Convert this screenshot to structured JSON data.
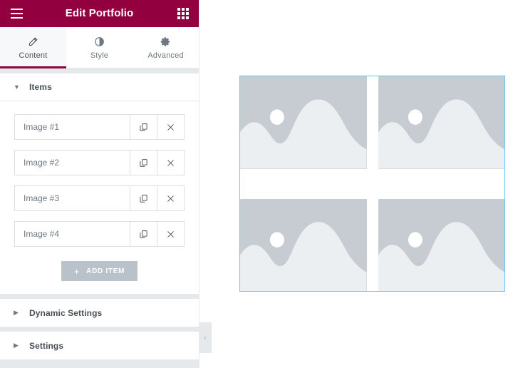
{
  "panel": {
    "header": {
      "menu_icon": "hamburger-menu-icon",
      "title": "Edit Portfolio",
      "apps_icon": "grid-apps-icon"
    },
    "tabs": [
      {
        "label": "Content",
        "icon": "pencil-icon",
        "active": true
      },
      {
        "label": "Style",
        "icon": "contrast-icon",
        "active": false
      },
      {
        "label": "Advanced",
        "icon": "gear-icon",
        "active": false
      }
    ],
    "sections": [
      {
        "id": "items",
        "title": "Items",
        "expanded": true,
        "caret": "▼"
      },
      {
        "id": "dynamic-settings",
        "title": "Dynamic Settings",
        "expanded": false,
        "caret": "▶"
      },
      {
        "id": "settings",
        "title": "Settings",
        "expanded": false,
        "caret": "▶"
      }
    ],
    "items": [
      {
        "label": "Image #1",
        "duplicate_icon": "duplicate-icon",
        "remove_icon": "close-icon"
      },
      {
        "label": "Image #2",
        "duplicate_icon": "duplicate-icon",
        "remove_icon": "close-icon"
      },
      {
        "label": "Image #3",
        "duplicate_icon": "duplicate-icon",
        "remove_icon": "close-icon"
      },
      {
        "label": "Image #4",
        "duplicate_icon": "duplicate-icon",
        "remove_icon": "close-icon"
      }
    ],
    "add_item": {
      "plus": "+",
      "label": "ADD ITEM"
    },
    "collapse_handle": {
      "icon": "chevron-left-icon",
      "glyph": "‹"
    }
  },
  "canvas": {
    "widget_name": "portfolio-widget",
    "selected": true,
    "selection_color": "#59cbf5",
    "placeholders": [
      {
        "name": "portfolio-image-1",
        "alt": "image-placeholder"
      },
      {
        "name": "portfolio-image-2",
        "alt": "image-placeholder"
      },
      {
        "name": "portfolio-image-3",
        "alt": "image-placeholder"
      },
      {
        "name": "portfolio-image-4",
        "alt": "image-placeholder"
      }
    ]
  },
  "colors": {
    "brand": "#93003f",
    "panel_bg": "#e6e9ec",
    "section_bg": "#ffffff",
    "text": "#495157",
    "muted_text": "#6d7882",
    "button_bg": "#b9c2ca",
    "selection": "#59cbf5",
    "placeholder_bg": "#c6ccd2",
    "placeholder_shape": "#eceff1"
  }
}
